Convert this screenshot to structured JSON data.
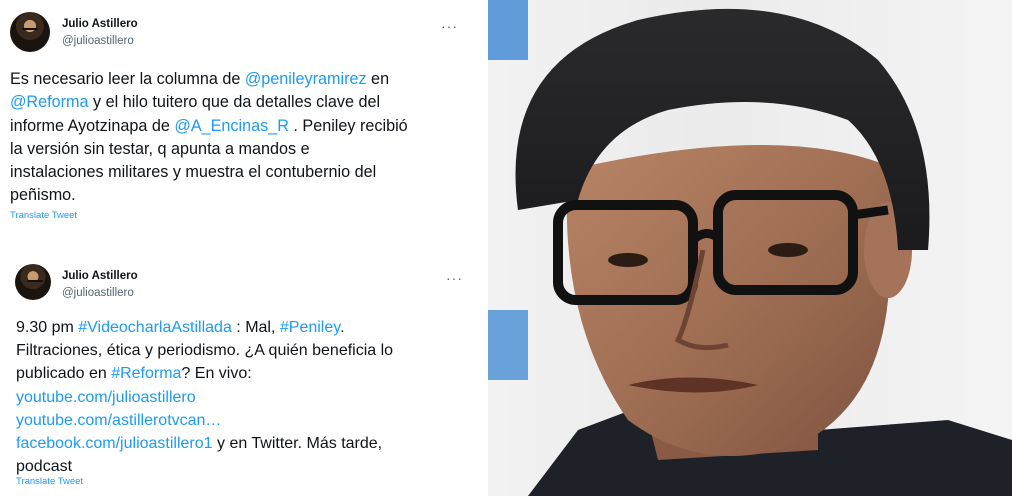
{
  "tweets": [
    {
      "author": {
        "name": "Julio Astillero",
        "handle": "@julioastillero"
      },
      "more_icon": "more-horizontal-icon",
      "lines": [
        [
          {
            "t": "Es necesario leer la columna de "
          },
          {
            "t": "@penileyramirez",
            "link": true
          },
          {
            "t": " en"
          }
        ],
        [
          {
            "t": "@Reforma",
            "link": true
          },
          {
            "t": " y el hilo tuitero que da detalles clave del"
          }
        ],
        [
          {
            "t": "informe Ayotzinapa de "
          },
          {
            "t": "@A_Encinas_R",
            "link": true
          },
          {
            "t": " . Peniley recibió"
          }
        ],
        [
          {
            "t": "la versión sin testar, q apunta a mandos e"
          }
        ],
        [
          {
            "t": "instalaciones militares y muestra el contubernio del"
          }
        ],
        [
          {
            "t": "peñismo."
          }
        ]
      ],
      "translate_label": "Translate Tweet"
    },
    {
      "author": {
        "name": "Julio Astillero",
        "handle": "@julioastillero"
      },
      "more_icon": "more-horizontal-icon",
      "lines": [
        [
          {
            "t": "9.30 pm "
          },
          {
            "t": "#VideocharlaAstillada",
            "link": true
          },
          {
            "t": " : Mal, "
          },
          {
            "t": "#Peniley",
            "link": true
          },
          {
            "t": "."
          }
        ],
        [
          {
            "t": "Filtraciones, ética y periodismo. ¿A quién beneficia lo"
          }
        ],
        [
          {
            "t": "publicado en "
          },
          {
            "t": "#Reforma",
            "link": true
          },
          {
            "t": "? En vivo:"
          }
        ],
        [
          {
            "t": "youtube.com/julioastillero",
            "link": true
          }
        ],
        [
          {
            "t": "youtube.com/astillerotvcan…",
            "link": true
          }
        ],
        [
          {
            "t": "facebook.com/julioastillero1",
            "link": true
          },
          {
            "t": " y en Twitter. Más tarde,"
          }
        ],
        [
          {
            "t": "podcast"
          }
        ]
      ],
      "translate_label": "Translate Tweet"
    }
  ],
  "photo": {
    "subject": "portrait-photo"
  },
  "colors": {
    "link": "#1d9bf0",
    "text": "#0f1419",
    "muted": "#536471"
  }
}
